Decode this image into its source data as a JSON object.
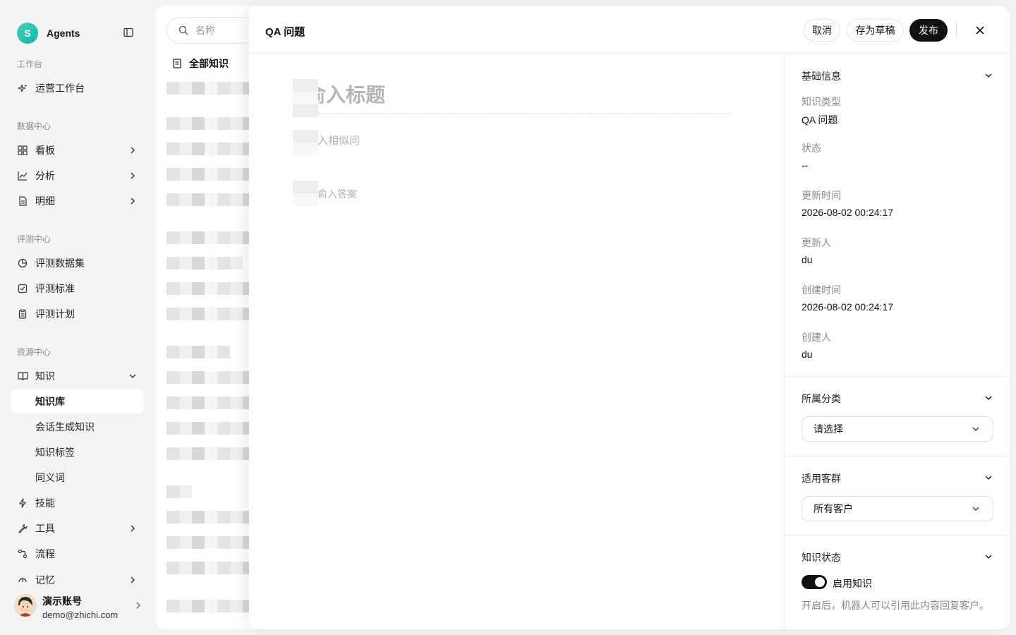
{
  "brand": {
    "logo_letter": "S",
    "name": "Agents"
  },
  "sidebar": {
    "sections": [
      {
        "title": "工作台"
      },
      {
        "title": "数据中心"
      },
      {
        "title": "评测中心"
      },
      {
        "title": "资源中心"
      }
    ],
    "items": {
      "ops": "运营工作台",
      "board": "看板",
      "analysis": "分析",
      "detail": "明细",
      "eval_dataset": "评测数据集",
      "eval_standard": "评测标准",
      "eval_plan": "评测计划",
      "knowledge": "知识",
      "knowledge_base": "知识库",
      "session_knowledge": "会话生成知识",
      "knowledge_tags": "知识标签",
      "synonyms": "同义词",
      "skills": "技能",
      "tools": "工具",
      "flows": "流程",
      "memory": "记忆"
    }
  },
  "user": {
    "name": "演示账号",
    "email": "demo@zhichi.com"
  },
  "list_panel": {
    "search_placeholder": "名称",
    "all_label": "全部知识"
  },
  "drawer": {
    "title": "QA 问题",
    "buttons": {
      "cancel": "取消",
      "draft": "存为草稿",
      "publish": "发布"
    },
    "editor": {
      "title_placeholder": "输入标题",
      "title_visible": "俞入标题",
      "similar_visible": "入相似问",
      "answer_visible": "俞入答案"
    },
    "basic": {
      "header": "基础信息",
      "type_label": "知识类型",
      "type_value": "QA 问题",
      "status_label": "状态",
      "status_value": "--",
      "updated_label": "更新时间",
      "updated_value": "2026-08-02 00:24:17",
      "updater_label": "更新人",
      "updater_value": "du",
      "created_label": "创建时间",
      "created_value": "2026-08-02 00:24:17",
      "creator_label": "创建人",
      "creator_value": "du"
    },
    "category": {
      "header": "所属分类",
      "select_value": "请选择"
    },
    "audience": {
      "header": "适用客群",
      "select_value": "所有客户"
    },
    "kstatus": {
      "header": "知识状态",
      "toggle_on": true,
      "toggle_label": "启用知识",
      "hint": "开启后，机器人可以引用此内容回复客户。"
    }
  }
}
